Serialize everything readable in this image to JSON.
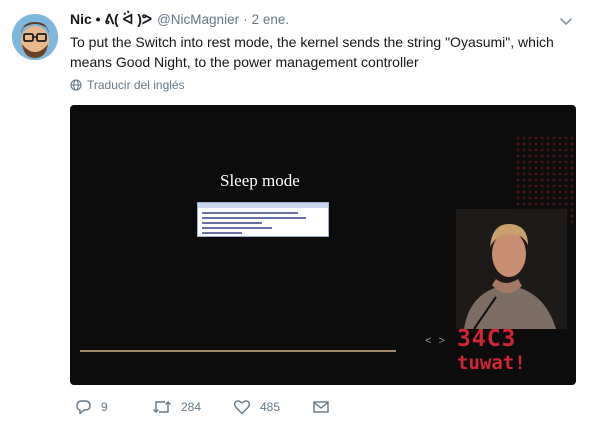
{
  "author": {
    "name": "Nic • ᕕ( ᐛ )ᕗ",
    "handle": "@NicMagnier",
    "separator": "·",
    "date": "2 ene."
  },
  "tweet": {
    "text": "To put the Switch into rest mode, the kernel sends the string \"Oyasumi\", which means Good Night, to the power management controller",
    "translate_label": "Traducir del inglés"
  },
  "media": {
    "slide_title": "Sleep mode",
    "nav_arrows": "< >",
    "logo_line1": "34C3",
    "logo_line2": "tuwat!"
  },
  "actions": {
    "replies": "9",
    "retweets": "284",
    "likes": "485"
  },
  "icons": [
    "avatar",
    "chevron-down-icon",
    "globe-icon",
    "reply-icon",
    "retweet-icon",
    "heart-icon",
    "mail-icon"
  ],
  "colors": {
    "text": "#14171a",
    "muted": "#657786",
    "logo_red": "#d32436",
    "link_blue": "#1da1f2"
  }
}
